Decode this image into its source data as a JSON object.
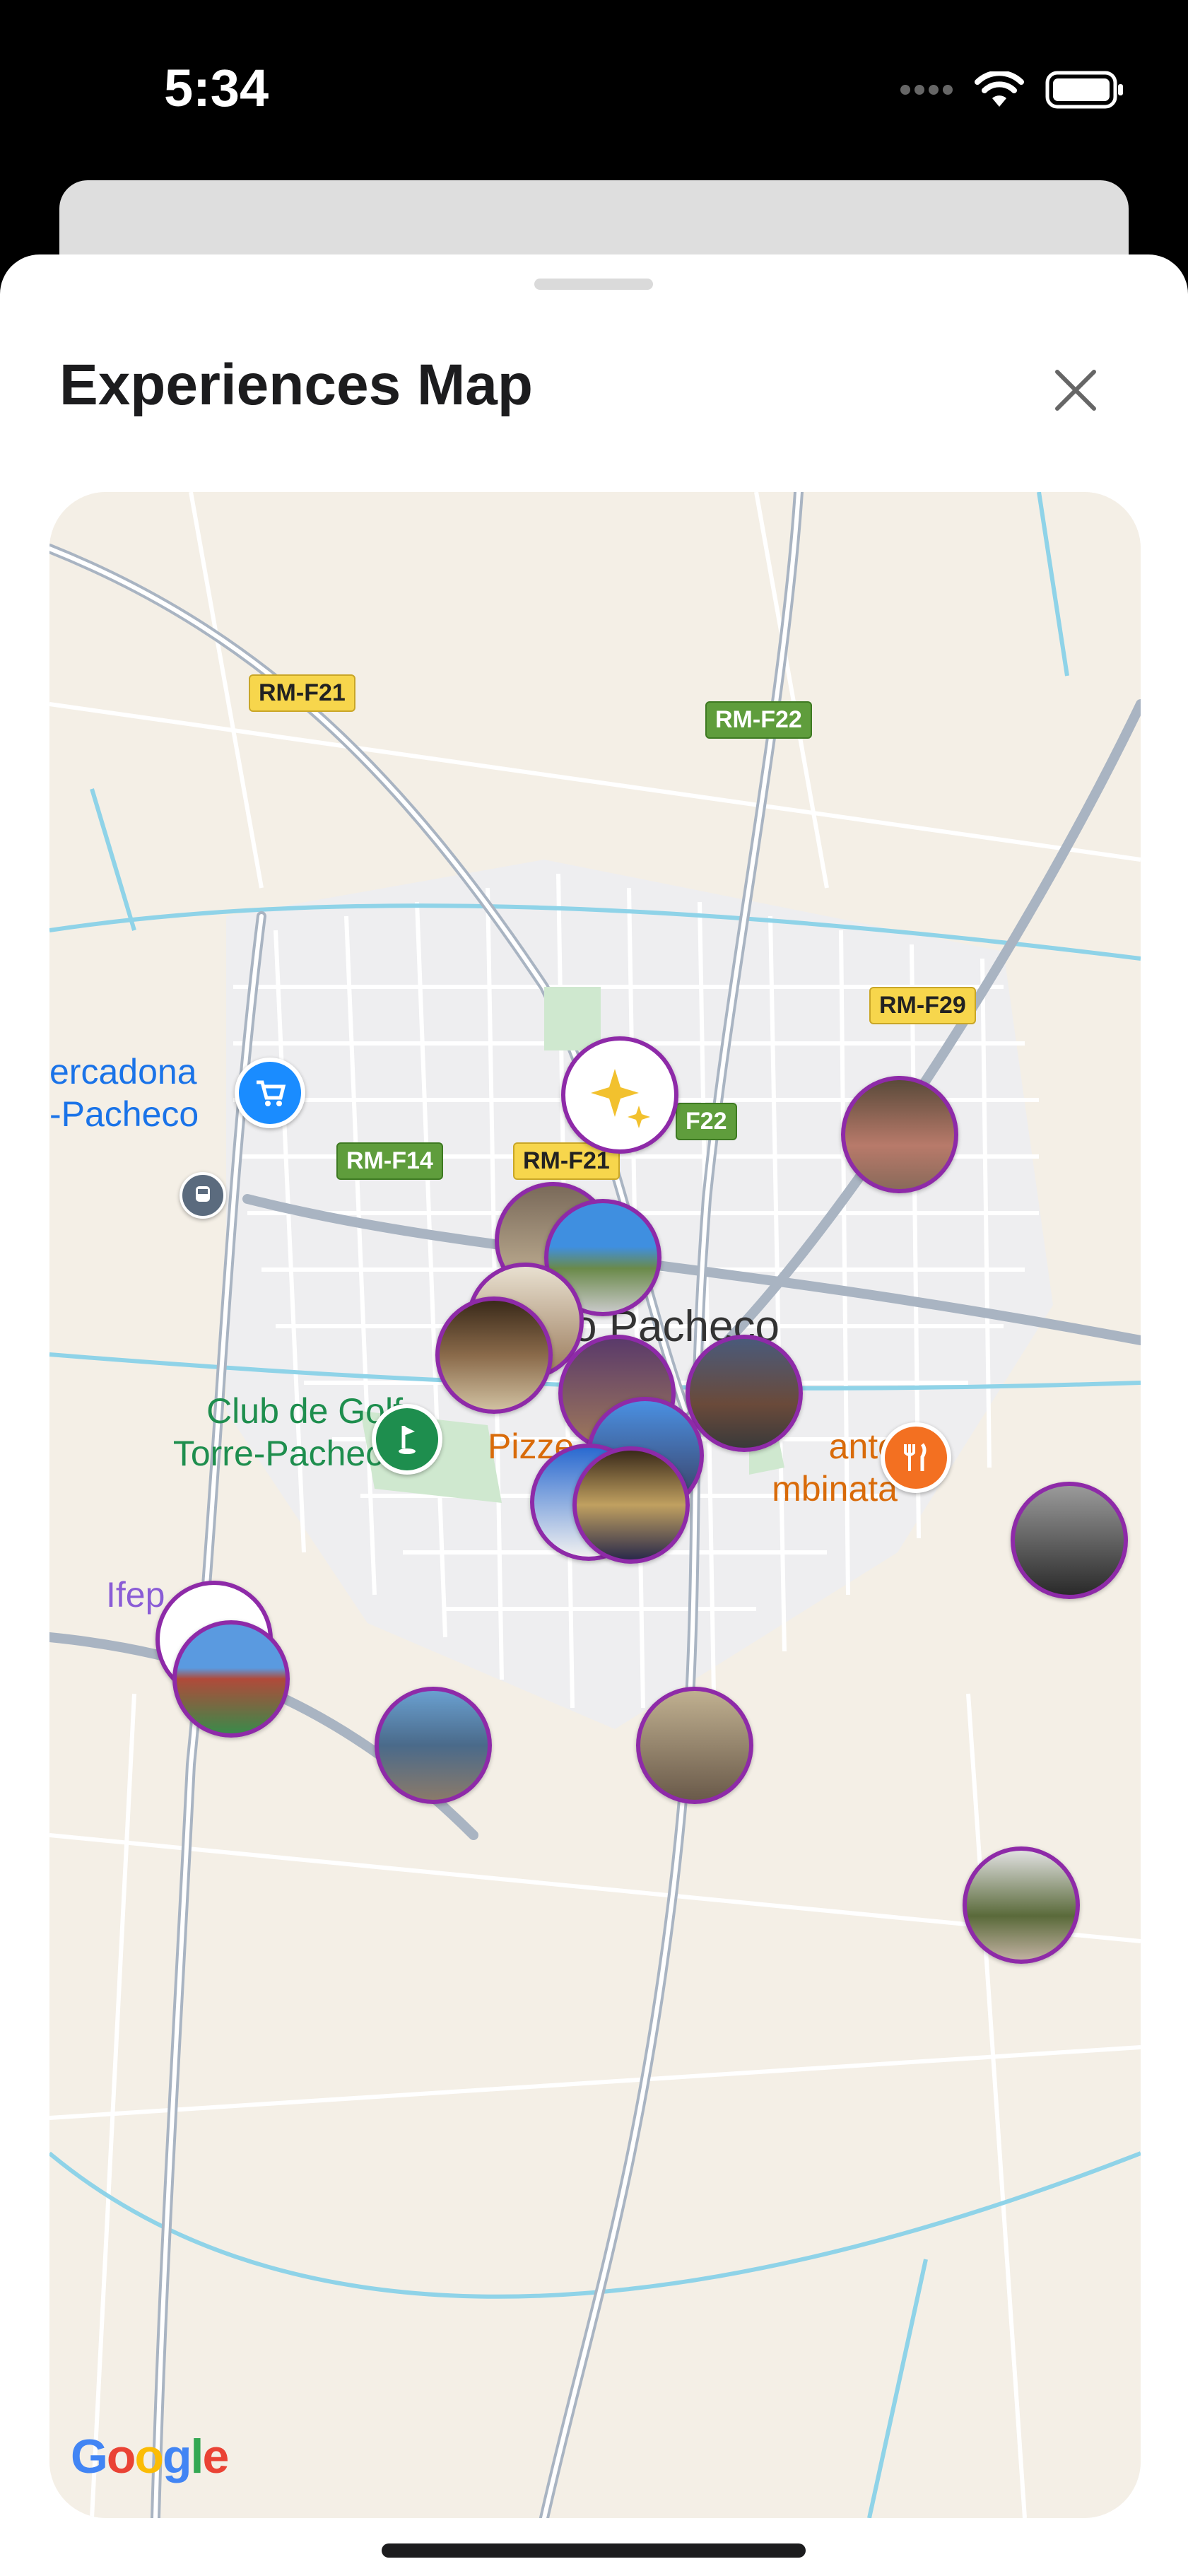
{
  "status_bar": {
    "time": "5:34"
  },
  "sheet": {
    "title": "Experiences Map"
  },
  "map": {
    "road_labels": [
      "RM-F21",
      "RM-F22",
      "RM-F29",
      "RM-F14",
      "RM-F21",
      "F22"
    ],
    "town_label": "o Pacheco",
    "pois": {
      "mercadona": "ercadona\n-Pacheco",
      "golf": "Club de Golf\nTorre-Pacheco",
      "restaurant_left": "Pizze",
      "restaurant_right": "ante\nmbinata",
      "ifep": "Ifep"
    },
    "attribution": "Google",
    "colors": {
      "marker_border": "#8e2aa8",
      "land": "#f4efe6",
      "road": "#ffffff",
      "highway": "#a9b4c2",
      "water": "#8fd3e8"
    }
  }
}
